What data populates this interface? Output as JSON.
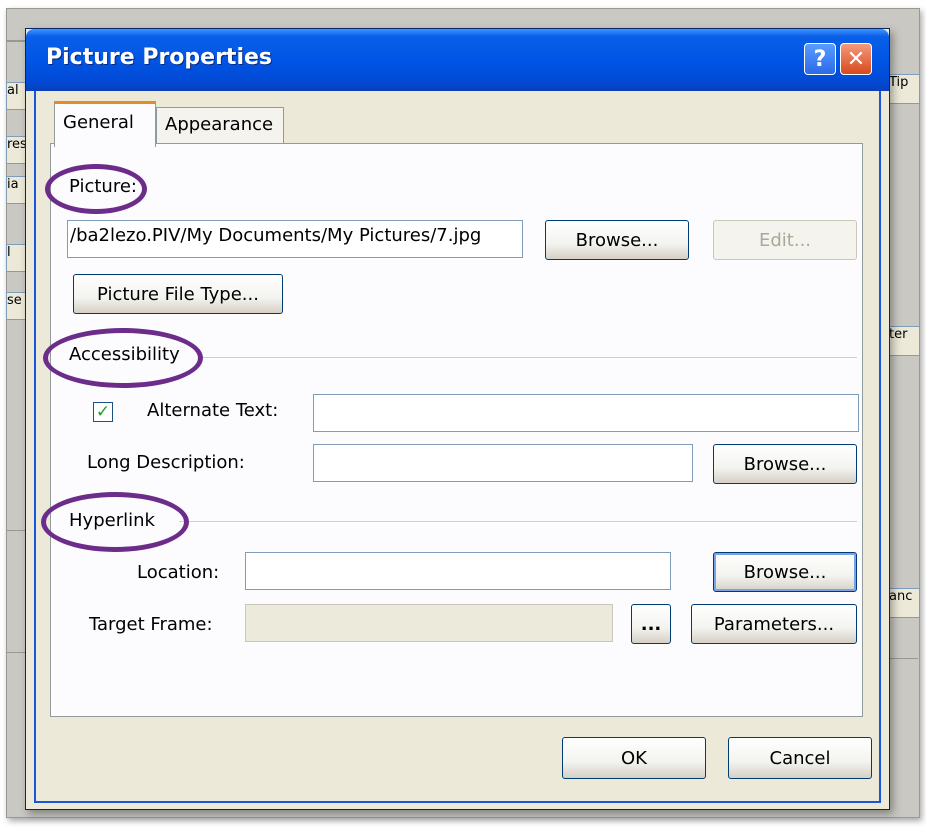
{
  "background": {
    "fragments": [
      "al",
      "res",
      "ia",
      "l",
      "se",
      "Tip",
      "ter",
      "anc"
    ]
  },
  "dialog": {
    "title": "Picture Properties",
    "help_label": "?",
    "close_label": "✕",
    "tabs": [
      {
        "label": "General",
        "active": true
      },
      {
        "label": "Appearance",
        "active": false
      }
    ],
    "picture": {
      "section_label": "Picture:",
      "path_value": "/ba2lezo.PIV/My Documents/My Pictures/7.jpg",
      "browse_label": "Browse...",
      "edit_label": "Edit...",
      "file_type_label": "Picture File Type..."
    },
    "accessibility": {
      "section_label": "Accessibility",
      "alt_checked": true,
      "alt_check_glyph": "✓",
      "alt_text_label": "Alternate Text:",
      "alt_text_value": "",
      "long_desc_label": "Long Description:",
      "long_desc_value": "",
      "browse_label": "Browse..."
    },
    "hyperlink": {
      "section_label": "Hyperlink",
      "location_label": "Location:",
      "location_value": "",
      "browse_label": "Browse...",
      "target_frame_label": "Target Frame:",
      "target_frame_value": "",
      "target_picker_label": "...",
      "parameters_label": "Parameters..."
    },
    "footer": {
      "ok_label": "OK",
      "cancel_label": "Cancel"
    },
    "colors": {
      "title_bar": "#0055e5",
      "highlight_ring": "#6b2c8a",
      "tab_accent": "#e68b2c"
    }
  }
}
